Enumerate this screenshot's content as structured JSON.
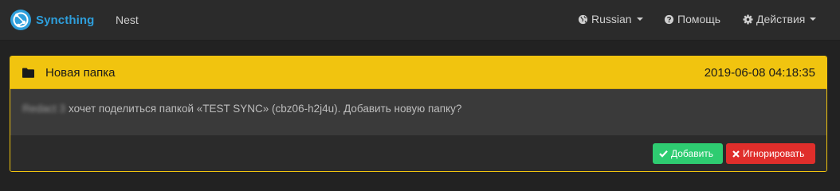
{
  "navbar": {
    "brand": "Syncthing",
    "device_name": "Nest",
    "language": "Russian",
    "help": "Помощь",
    "actions": "Действия"
  },
  "notification": {
    "folder_label": "Новая папка",
    "timestamp": "2019-06-08 04:18:35",
    "device_blurred": "Redact 3",
    "message": "хочет поделиться папкой «TEST SYNC» (cbz06-h2j4u). Добавить новую папку?",
    "add_label": "Добавить",
    "ignore_label": "Игнорировать"
  },
  "colors": {
    "brand": "#2e9fdc",
    "warning": "#f1c40f",
    "success": "#2ecc71",
    "danger": "#e02e2b"
  },
  "icons": {
    "brand": "syncthing-logo-icon",
    "language": "globe-icon",
    "help": "question-circle-icon",
    "actions": "gear-icon",
    "folder": "folder-icon",
    "add": "check-icon",
    "ignore": "times-icon"
  }
}
